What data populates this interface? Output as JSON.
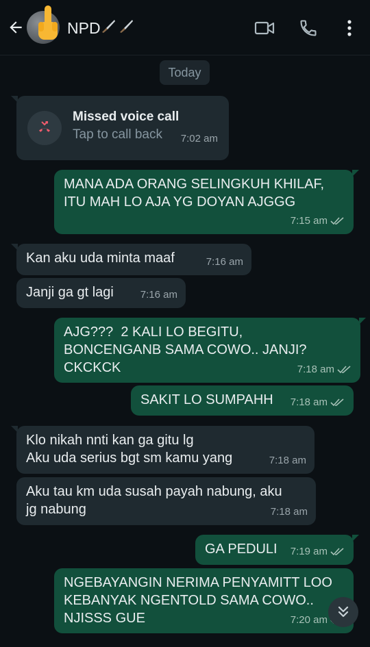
{
  "header": {
    "title": "NPD",
    "icons": [
      "back-arrow-icon",
      "avatar",
      "middle-finger-emoji-icon",
      "knife-icon",
      "video-call-icon",
      "phone-icon",
      "more-vert-icon"
    ]
  },
  "date_chip": "Today",
  "messages": [
    {
      "type": "missed_call",
      "direction": "in",
      "title": "Missed voice call",
      "subtitle": "Tap to call back",
      "time": "7:02 am"
    },
    {
      "direction": "out",
      "text": "MANA ADA ORANG SELINGKUH KHILAF,\nITU MAH LO AJA YG DOYAN AJGGG",
      "time": "7:15 am",
      "status": "read"
    },
    {
      "direction": "in",
      "text": "Kan aku uda minta maaf",
      "time": "7:16 am"
    },
    {
      "direction": "in",
      "text": "Janji ga gt lagi",
      "time": "7:16 am"
    },
    {
      "direction": "out",
      "text": "AJG???  2 KALI LO BEGITU,\nBONCENGANB SAMA COWO.. JANJI?\nCKCKCK",
      "time": "7:18 am",
      "status": "read"
    },
    {
      "direction": "out",
      "text": "SAKIT LO SUMPAHH",
      "time": "7:18 am",
      "status": "read"
    },
    {
      "direction": "in",
      "text": "Klo nikah nnti kan ga gitu lg\nAku uda serius bgt sm kamu yang",
      "time": "7:18 am"
    },
    {
      "direction": "in",
      "text": "Aku tau km uda susah payah nabung, aku\njg nabung",
      "time": "7:18 am"
    },
    {
      "direction": "out",
      "text": "GA PEDULI",
      "time": "7:19 am",
      "status": "read"
    },
    {
      "direction": "out",
      "text": "NGEBAYANGIN NERIMA PENYAMITT LOO\nKEBANYAK NGENTOLD SAMA COWO..\nNJISSS GUE",
      "time": "7:20 am",
      "status": "read"
    }
  ],
  "colors": {
    "background": "#0b1014",
    "incoming_bubble": "#1f2a30",
    "outgoing_bubble": "#12503c",
    "missed_call_red": "#f15c6d",
    "read_ticks": "#a8c2b8"
  }
}
